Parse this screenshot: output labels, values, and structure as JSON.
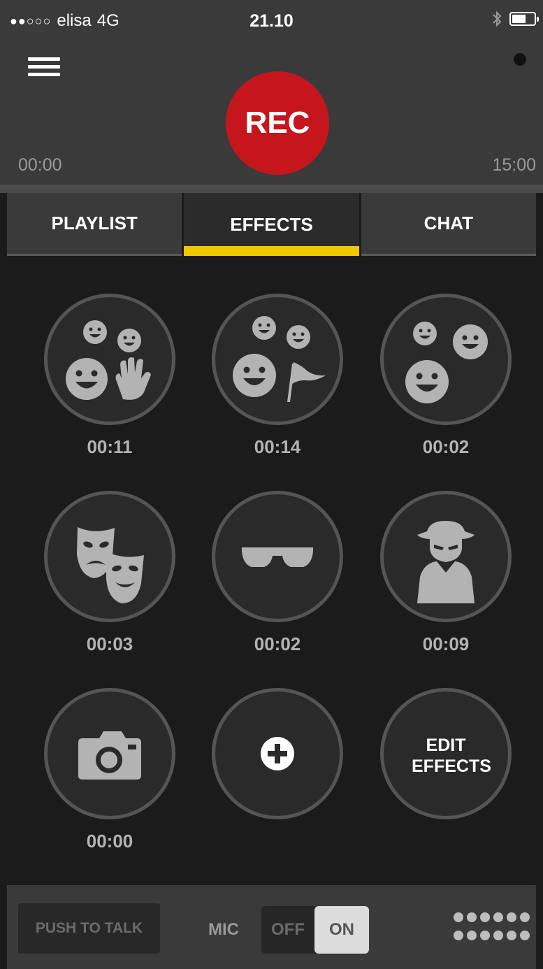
{
  "status_bar": {
    "signal": "●●○○○",
    "carrier": "elisa",
    "network": "4G",
    "time": "21.10"
  },
  "header": {
    "rec_label": "REC",
    "time_start": "00:00",
    "time_end": "15:00"
  },
  "tabs": [
    {
      "label": "PLAYLIST",
      "active": false
    },
    {
      "label": "EFFECTS",
      "active": true
    },
    {
      "label": "CHAT",
      "active": false
    }
  ],
  "effects": [
    {
      "icon": "smiley-clap-icon",
      "time": "00:11"
    },
    {
      "icon": "smiley-flag-icon",
      "time": "00:14"
    },
    {
      "icon": "smiley-group-icon",
      "time": "00:02"
    },
    {
      "icon": "theater-masks-icon",
      "time": "00:03"
    },
    {
      "icon": "sunglasses-icon",
      "time": "00:02"
    },
    {
      "icon": "spy-icon",
      "time": "00:09"
    },
    {
      "icon": "camera-icon",
      "time": "00:00"
    },
    {
      "icon": "plus-icon"
    },
    {
      "label": "EDIT EFFECTS"
    }
  ],
  "footer": {
    "push_to_talk": "PUSH TO TALK",
    "mic_label": "MIC",
    "toggle_off": "OFF",
    "toggle_on": "ON"
  },
  "colors": {
    "accent": "#f0c800",
    "rec": "#c4161c",
    "panel": "#3a3a3a",
    "background": "#1b1b1b",
    "icon": "#b3b3b3"
  }
}
